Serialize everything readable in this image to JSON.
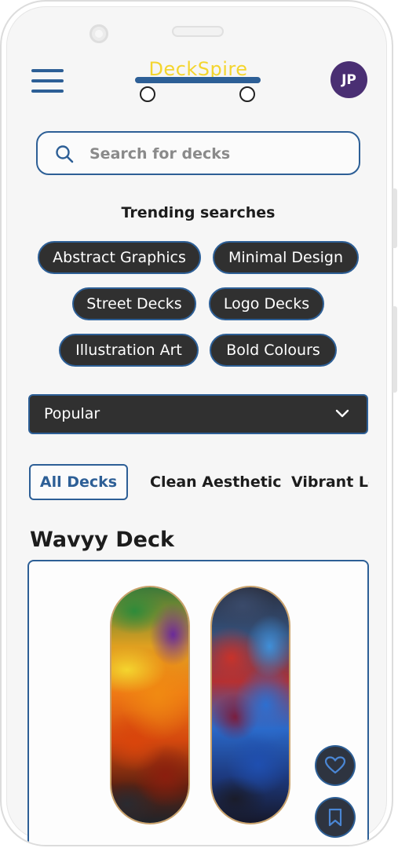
{
  "app": {
    "logo_text": "DeckSpire",
    "avatar_initials": "JP"
  },
  "search": {
    "placeholder": "Search for decks",
    "value": ""
  },
  "trending": {
    "title": "Trending searches",
    "chips": [
      "Abstract Graphics",
      "Minimal Design",
      "Street Decks",
      "Logo Decks",
      "Illustration Art",
      "Bold Colours"
    ]
  },
  "sort": {
    "selected": "Popular"
  },
  "tabs": [
    {
      "label": "All Decks",
      "active": true
    },
    {
      "label": "Clean Aesthetic",
      "active": false
    },
    {
      "label": "Vibrant Logos",
      "active": false
    }
  ],
  "product": {
    "title": "Wavyy Deck"
  },
  "colors": {
    "accent_blue": "#2d5f96",
    "logo_yellow": "#f4d52e",
    "avatar_purple": "#4a2f73",
    "chip_dark": "#303030"
  },
  "icons": {
    "menu": "hamburger-icon",
    "search": "search-icon",
    "dropdown": "chevron-down-icon",
    "like": "heart-icon",
    "save": "bookmark-icon"
  }
}
